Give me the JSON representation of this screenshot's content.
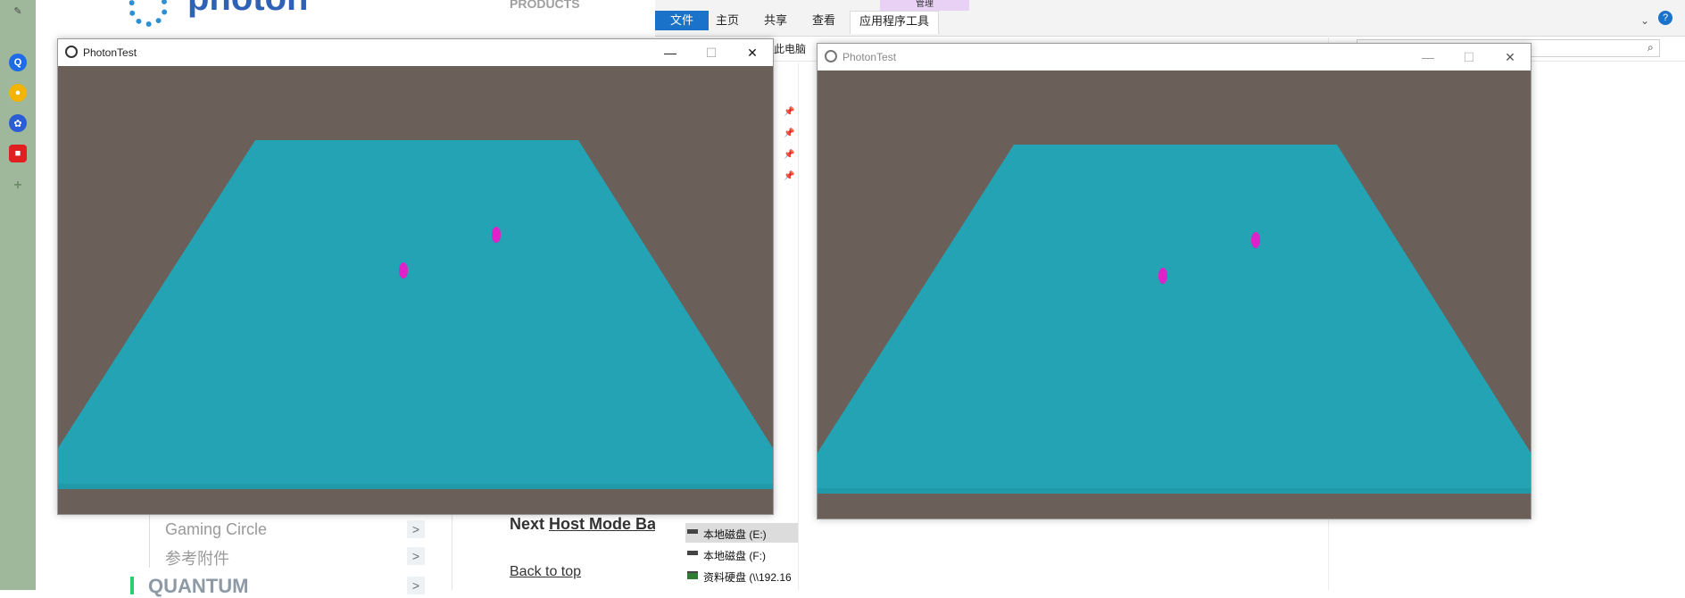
{
  "webpage": {
    "logo_text": "photon",
    "top_nav": "PRODUCTS",
    "sidebar": [
      {
        "label": "Gaming Circle",
        "chevron": ">"
      },
      {
        "label": "参考附件",
        "chevron": ">"
      },
      {
        "label": "QUANTUM",
        "chevron": ">"
      }
    ],
    "next_prefix": "Next",
    "next_link": "Host Mode Bas",
    "back_to_top": "Back to top"
  },
  "explorer": {
    "context_tab_label": "管理",
    "tabs": [
      "文件",
      "主页",
      "共享",
      "查看",
      "应用程序工具"
    ],
    "address_first": "此电脑",
    "drives": [
      {
        "label": "本地磁盘 (E:)",
        "selected": true
      },
      {
        "label": "本地磁盘 (F:)",
        "selected": false
      },
      {
        "label": "资料硬盘 (\\\\192.16",
        "selected": false
      }
    ]
  },
  "windows": [
    {
      "title": "PhotonTest",
      "focused": true
    },
    {
      "title": "PhotonTest",
      "focused": false
    }
  ],
  "scene": {
    "colors": {
      "background": "#6b5f59",
      "floor": "#23a3b3",
      "floor_edge": "#209aa9",
      "capsule": "#e020c8"
    }
  },
  "controls": {
    "minimize": "—",
    "maximize": "☐",
    "close": "✕"
  }
}
